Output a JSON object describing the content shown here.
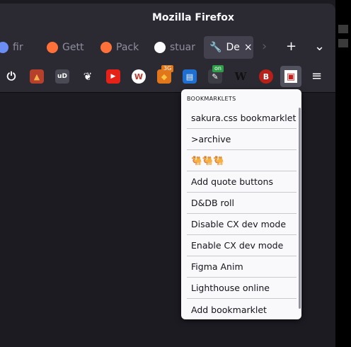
{
  "window": {
    "title": "Mozilla Firefox"
  },
  "tabs": [
    {
      "label": "fir",
      "icon": "sleep-zz-icon",
      "color": "#6b8ef5"
    },
    {
      "label": "Gett",
      "icon": "firefox-icon",
      "color": "#ff7139"
    },
    {
      "label": "Pack",
      "icon": "firefox-icon",
      "color": "#ff7139"
    },
    {
      "label": "stuar",
      "icon": "github-icon",
      "color": "#fbfbfe"
    },
    {
      "label": "De",
      "icon": "wrench-icon",
      "color": "#fbfbfe",
      "active": true
    }
  ],
  "tabbar": {
    "scroll_right_glyph": "›",
    "new_tab_glyph": "+",
    "list_all_tabs_glyph": "⌄",
    "close_glyph": "×"
  },
  "toolbar": {
    "extensions": [
      {
        "name": "power-icon",
        "glyph": "⏻",
        "bg": "transparent",
        "fg": "#fbfbfe"
      },
      {
        "name": "fox-extension-icon",
        "glyph": "▲",
        "bg": "#b6402b",
        "fg": "#f2b24c"
      },
      {
        "name": "ublock-icon",
        "glyph": "uD",
        "bg": "#4a4a55",
        "fg": "#ffffff"
      },
      {
        "name": "gnome-paw-icon",
        "glyph": "❦",
        "bg": "transparent",
        "fg": "#fbfbfe"
      },
      {
        "name": "youtube-icon",
        "glyph": "▶",
        "bg": "#e62117",
        "fg": "#ffffff"
      },
      {
        "name": "w-circle-icon",
        "glyph": "W",
        "bg": "#ffffff",
        "fg": "#c0392b"
      },
      {
        "name": "metamask-icon",
        "glyph": "◆",
        "bg": "#e2761b",
        "fg": "#f6c343"
      },
      {
        "name": "notes-icon",
        "glyph": "▤",
        "bg": "#1f6fd1",
        "fg": "#ffffff"
      },
      {
        "name": "toggle-on-icon",
        "glyph": "✎",
        "bg": "#3c3c44",
        "fg": "#ffffff"
      },
      {
        "name": "wikipedia-icon",
        "glyph": "W",
        "bg": "transparent",
        "fg": "#111111"
      },
      {
        "name": "bitwarden-icon",
        "glyph": "B",
        "bg": "#b8201a",
        "fg": "#ffffff"
      },
      {
        "name": "bookmarklets-icon",
        "glyph": "▣",
        "bg": "#ffffff",
        "fg": "#c02222"
      }
    ],
    "badge_3g": "3G",
    "badge_on": "on",
    "menu_glyph": "≡"
  },
  "panel": {
    "title": "BOOKMARKLETS",
    "items": [
      "sakura.css bookmarklet",
      ">archive",
      "🐫🐫🐫",
      "Add quote buttons",
      "D&DB roll",
      "Disable CX dev mode",
      "Enable CX dev mode",
      "Figma Anim",
      "Lighthouse online",
      "Add bookmarklet"
    ]
  }
}
